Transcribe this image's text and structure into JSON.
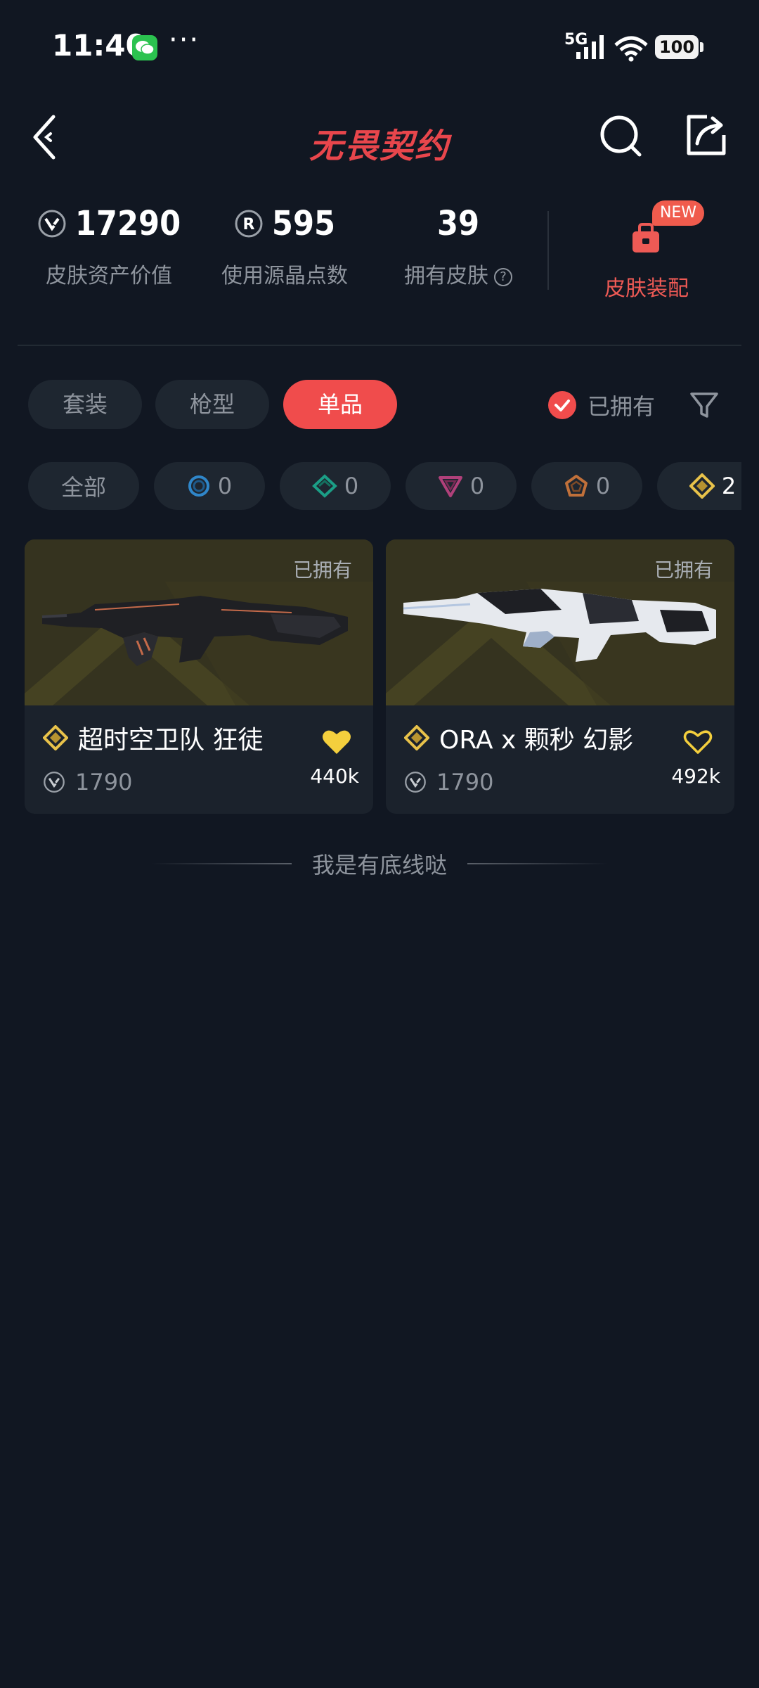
{
  "status_bar": {
    "time": "11:40",
    "more": "···",
    "network": "5G",
    "battery": "100",
    "icons": [
      "wechat-icon",
      "signal-icon",
      "wifi-icon",
      "battery-icon"
    ]
  },
  "nav": {
    "title": "无畏契约",
    "icons": [
      "back-icon",
      "search-icon",
      "share-icon"
    ],
    "accent_color": "#e8464c"
  },
  "stats": {
    "asset_value": {
      "value": "17290",
      "label": "皮肤资产价值",
      "icon": "vp-icon"
    },
    "radianite": {
      "value": "595",
      "label": "使用源晶点数",
      "icon": "radianite-icon"
    },
    "owned_skins": {
      "value": "39",
      "label": "拥有皮肤",
      "icon": "help-icon"
    },
    "equip": {
      "badge": "NEW",
      "label": "皮肤装配",
      "icon": "loadout-icon"
    }
  },
  "tabs": {
    "items": [
      {
        "label": "套装",
        "active": false
      },
      {
        "label": "枪型",
        "active": false
      },
      {
        "label": "单品",
        "active": true
      }
    ],
    "owned_filter": {
      "label": "已拥有",
      "checked": true
    },
    "filter_icon": "filter-icon"
  },
  "tiers": [
    {
      "label": "全部",
      "count": ""
    },
    {
      "tier": "select-tier-icon",
      "count": "0",
      "color": "#2f86c9"
    },
    {
      "tier": "deluxe-tier-icon",
      "count": "0",
      "color": "#1b9e86"
    },
    {
      "tier": "premium-tier-icon",
      "count": "0",
      "color": "#b0407a"
    },
    {
      "tier": "exclusive-tier-icon",
      "count": "0",
      "color": "#c0703a"
    },
    {
      "tier": "ultra-tier-icon",
      "count": "2",
      "color": "#e8c24a"
    }
  ],
  "cards": [
    {
      "owned": "已拥有",
      "name": "超时空卫队 狂徒",
      "price": "1790",
      "likes": "440k",
      "liked": true
    },
    {
      "owned": "已拥有",
      "name": "ORA x 颗秒 幻影",
      "price": "1790",
      "likes": "492k",
      "liked": false
    }
  ],
  "footer": {
    "text": "我是有底线哒"
  }
}
